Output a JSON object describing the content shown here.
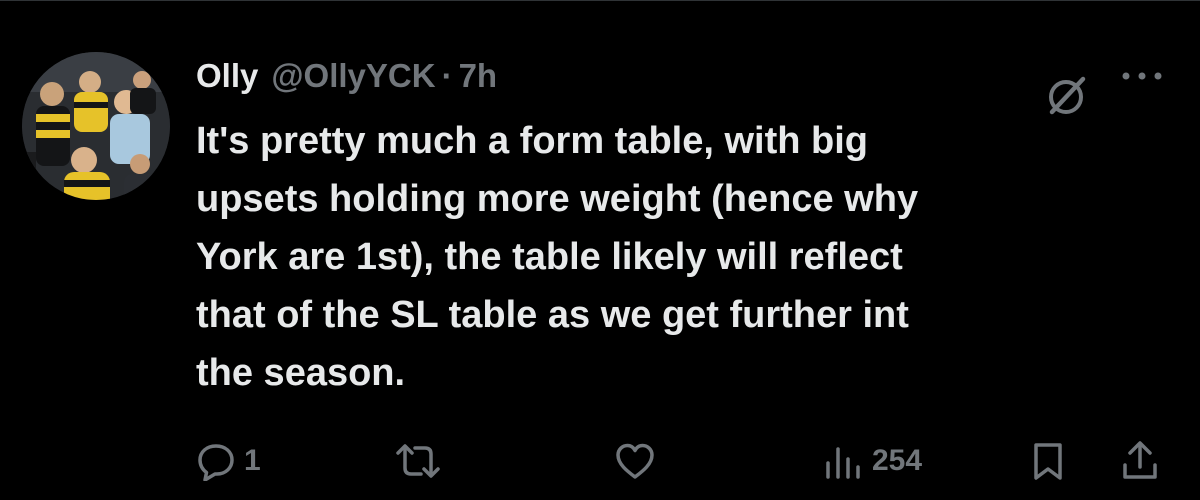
{
  "tweet": {
    "author": {
      "display_name": "Olly",
      "handle": "@OllyYCK",
      "separator": "·",
      "time": "7h"
    },
    "text": "It's pretty much a form table, with big\nupsets holding more weight (hence why\nYork are 1st), the table likely will reflect\nthat of the SL table as we get further int\nthe season.",
    "actions": {
      "reply_count": "1",
      "retweet_count": "",
      "like_count": "",
      "views_count": "254"
    }
  },
  "icons": {
    "header_right": [
      "grok-icon",
      "more-icon"
    ],
    "actions": [
      "reply-icon",
      "retweet-icon",
      "like-icon",
      "views-icon",
      "bookmark-icon",
      "share-icon"
    ]
  },
  "colors": {
    "background": "#000000",
    "primary_text": "#e7e9ea",
    "secondary_text": "#71767b",
    "avatar_yellow": "#e6c229"
  }
}
